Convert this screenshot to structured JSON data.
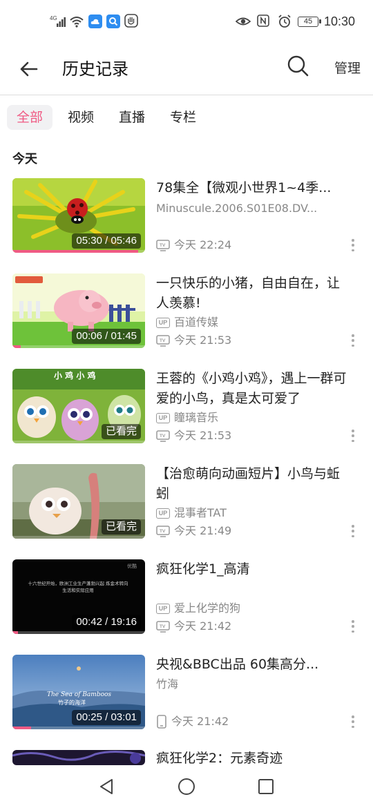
{
  "status_bar": {
    "network": "4G",
    "battery": "45",
    "time": "10:30"
  },
  "header": {
    "title": "历史记录",
    "manage_label": "管理"
  },
  "tabs": [
    {
      "label": "全部",
      "active": true
    },
    {
      "label": "视频",
      "active": false
    },
    {
      "label": "直播",
      "active": false
    },
    {
      "label": "专栏",
      "active": false
    }
  ],
  "section": {
    "title": "今天"
  },
  "items": [
    {
      "title": "78集全【微观小世界1~4季...",
      "subtitle": "Minuscule.2006.S01E08.DV...",
      "uploader": "",
      "device": "tv",
      "time": "今天 22:24",
      "duration": "05:30 / 05:46",
      "progress": 0.95
    },
    {
      "title": "一只快乐的小猪，自由自在，让人羡慕!",
      "subtitle": "",
      "uploader": "百道传媒",
      "device": "tv",
      "time": "今天 21:53",
      "duration": "00:06 / 01:45",
      "progress": 0.06
    },
    {
      "title": "王蓉的《小鸡小鸡》，遇上一群可爱的小鸟，真是太可爱了",
      "subtitle": "",
      "uploader": "瞳璃音乐",
      "device": "tv",
      "time": "今天 21:53",
      "duration": "已看完",
      "progress": 1
    },
    {
      "title": "【治愈萌向动画短片】小鸟与蚯蚓",
      "subtitle": "",
      "uploader": "混事者TAT",
      "device": "tv",
      "time": "今天 21:49",
      "duration": "已看完",
      "progress": 1
    },
    {
      "title": "疯狂化学1_高清",
      "subtitle": "",
      "uploader": "爱上化学的狗",
      "device": "tv",
      "time": "今天 21:42",
      "duration": "00:42 / 19:16",
      "progress": 0.04
    },
    {
      "title": "央视&BBC出品 60集高分...",
      "subtitle": "竹海",
      "uploader": "",
      "device": "phone",
      "time": "今天 21:42",
      "duration": "00:25 / 03:01",
      "progress": 0.14
    },
    {
      "title": "疯狂化学2：元素奇迹",
      "subtitle": "",
      "uploader": "",
      "device": "",
      "time": "",
      "duration": "",
      "progress": 0
    }
  ],
  "thumb_text": {
    "chick": "小 鸡 小 鸡",
    "chemistry_caption": "十六世纪开始，欧洲工业生产蓬勃兴起 炼金术转向生活和实际应用",
    "chemistry_logo": "优酷",
    "bamboo_en": "The Sea of Bamboos",
    "bamboo_cn": "竹子的海洋"
  },
  "badges": {
    "up": "UP"
  },
  "colors": {
    "accent": "#f05a84",
    "text": "#222222",
    "muted": "#888888"
  }
}
